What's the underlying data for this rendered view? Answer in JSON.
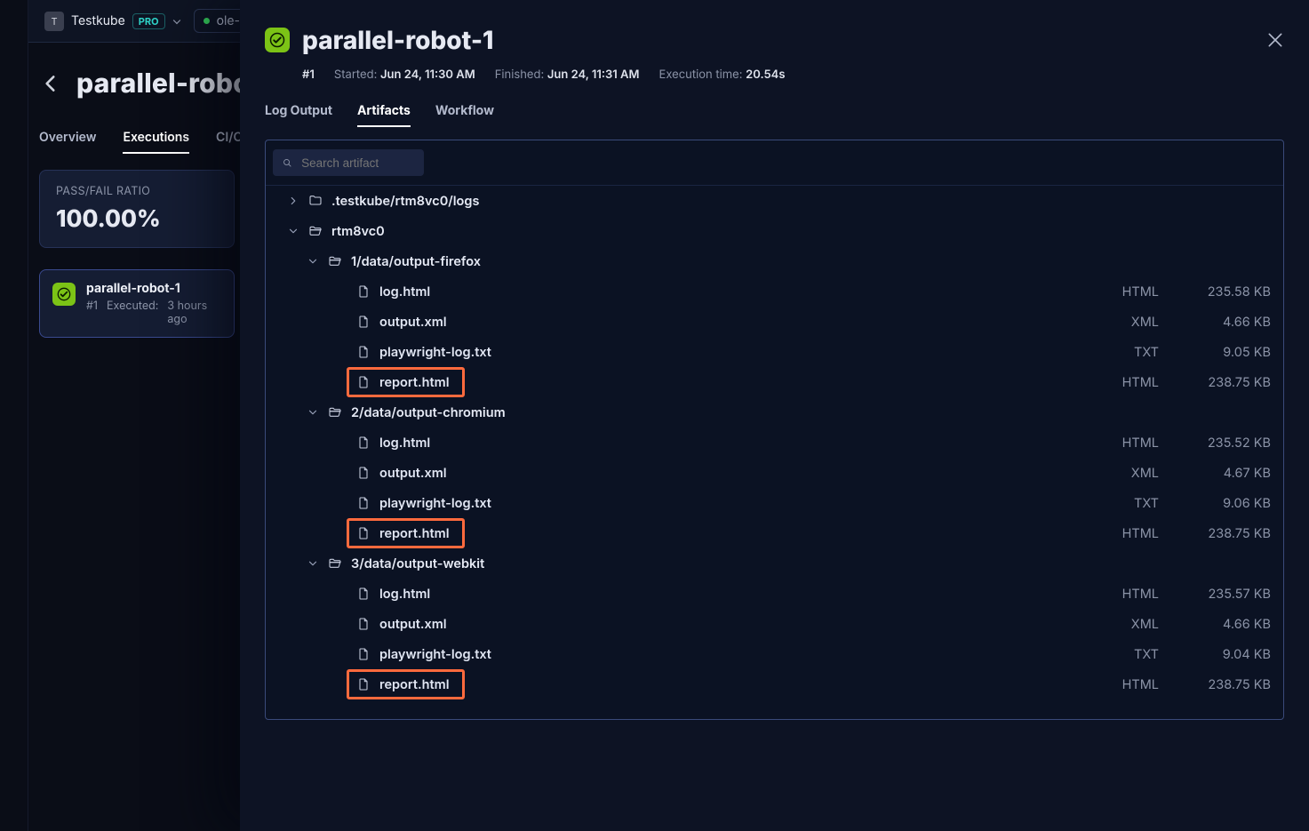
{
  "app": {
    "org_letter": "T",
    "org_name": "Testkube",
    "badge": "PRO",
    "env": "ole-m"
  },
  "back": {
    "title": "parallel-robot",
    "tabs": {
      "overview": "Overview",
      "executions": "Executions",
      "cicd": "CI/CD In"
    },
    "ratio": {
      "label": "PASS/FAIL RATIO",
      "value": "100.00%"
    },
    "execCard": {
      "name": "parallel-robot-1",
      "run": "#1",
      "lbl": "Executed:",
      "ago": "3 hours ago"
    }
  },
  "drawer": {
    "title": "parallel-robot-1",
    "run": "#1",
    "started_lbl": "Started:",
    "started_val": "Jun 24, 11:30 AM",
    "finished_lbl": "Finished:",
    "finished_val": "Jun 24, 11:31 AM",
    "dur_lbl": "Execution time:",
    "dur_val": "20.54s",
    "tabs": {
      "log": "Log Output",
      "artifacts": "Artifacts",
      "workflow": "Workflow"
    }
  },
  "search": {
    "placeholder": "Search artifact"
  },
  "tree": [
    {
      "kind": "folder",
      "depth": 0,
      "chev": "right",
      "icon": "folder",
      "name": ".testkube/rtm8vc0/logs"
    },
    {
      "kind": "folder",
      "depth": 0,
      "chev": "down",
      "icon": "folder-open",
      "name": "rtm8vc0"
    },
    {
      "kind": "folder",
      "depth": 1,
      "chev": "down",
      "icon": "folder-open",
      "name": "1/data/output-firefox"
    },
    {
      "kind": "file",
      "depth": 2,
      "name": "log.html",
      "type": "HTML",
      "size": "235.58 KB"
    },
    {
      "kind": "file",
      "depth": 2,
      "name": "output.xml",
      "type": "XML",
      "size": "4.66 KB"
    },
    {
      "kind": "file",
      "depth": 2,
      "name": "playwright-log.txt",
      "type": "TXT",
      "size": "9.05 KB"
    },
    {
      "kind": "file",
      "depth": 2,
      "name": "report.html",
      "type": "HTML",
      "size": "238.75 KB",
      "hl": true
    },
    {
      "kind": "folder",
      "depth": 1,
      "chev": "down",
      "icon": "folder-open",
      "name": "2/data/output-chromium"
    },
    {
      "kind": "file",
      "depth": 2,
      "name": "log.html",
      "type": "HTML",
      "size": "235.52 KB"
    },
    {
      "kind": "file",
      "depth": 2,
      "name": "output.xml",
      "type": "XML",
      "size": "4.67 KB"
    },
    {
      "kind": "file",
      "depth": 2,
      "name": "playwright-log.txt",
      "type": "TXT",
      "size": "9.06 KB"
    },
    {
      "kind": "file",
      "depth": 2,
      "name": "report.html",
      "type": "HTML",
      "size": "238.75 KB",
      "hl": true
    },
    {
      "kind": "folder",
      "depth": 1,
      "chev": "down",
      "icon": "folder-open",
      "name": "3/data/output-webkit"
    },
    {
      "kind": "file",
      "depth": 2,
      "name": "log.html",
      "type": "HTML",
      "size": "235.57 KB"
    },
    {
      "kind": "file",
      "depth": 2,
      "name": "output.xml",
      "type": "XML",
      "size": "4.66 KB"
    },
    {
      "kind": "file",
      "depth": 2,
      "name": "playwright-log.txt",
      "type": "TXT",
      "size": "9.04 KB"
    },
    {
      "kind": "file",
      "depth": 2,
      "name": "report.html",
      "type": "HTML",
      "size": "238.75 KB",
      "hl": true
    }
  ]
}
